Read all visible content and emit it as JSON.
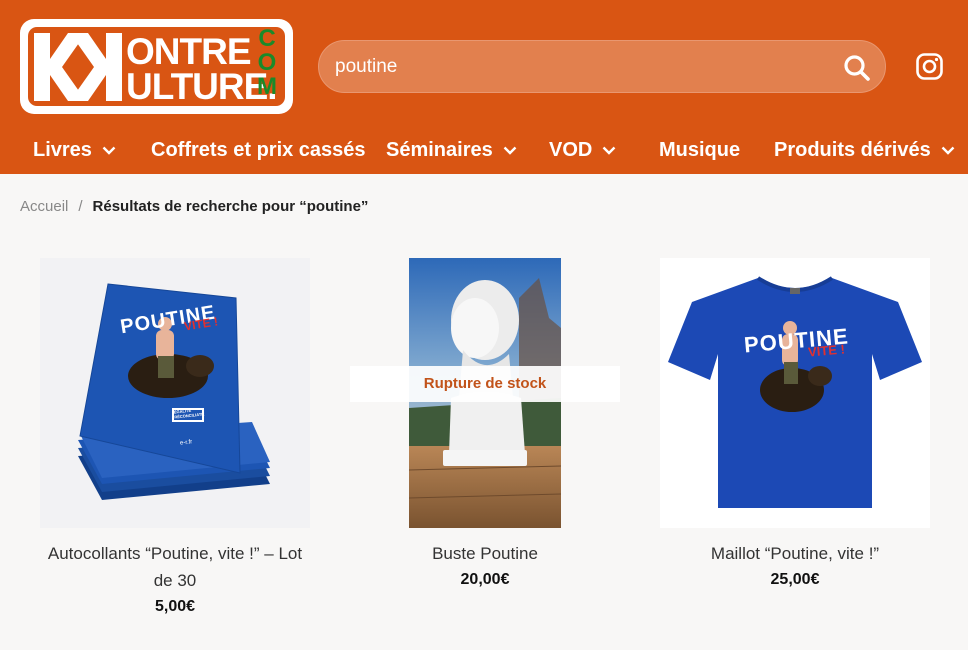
{
  "logo": {
    "line1": "ONTRE",
    "line2": "ULTURE.",
    "com": "COM"
  },
  "search": {
    "value": "poutine"
  },
  "nav": [
    {
      "label": "Livres",
      "has_dropdown": true
    },
    {
      "label": "Coffrets et prix cassés",
      "has_dropdown": false
    },
    {
      "label": "Séminaires",
      "has_dropdown": true
    },
    {
      "label": "VOD",
      "has_dropdown": true
    },
    {
      "label": "Musique",
      "has_dropdown": false
    },
    {
      "label": "Produits dérivés",
      "has_dropdown": true
    }
  ],
  "breadcrumb": {
    "home": "Accueil",
    "separator": "/",
    "current": "Résultats de recherche pour “poutine”"
  },
  "products": [
    {
      "title_line1": "Autocollants “Poutine, vite !” – Lot",
      "title_line2": "de 30",
      "price": "5,00€",
      "poster_text": "POUTINE",
      "poster_sub": "VITE !",
      "badge_text": "ÉGALITÉ RÉCONCILIATION",
      "site_text": "e-r.fr"
    },
    {
      "title": "Buste Poutine",
      "price": "20,00€",
      "badge": "Rupture de stock"
    },
    {
      "title": "Maillot “Poutine, vite !”",
      "price": "25,00€",
      "shirt_text": "POUTINE",
      "shirt_sub": "VITE !"
    }
  ],
  "colors": {
    "brand_orange": "#d95513",
    "logo_green": "#1a8a2a",
    "poster_blue": "#1d55b3",
    "shirt_blue": "#1c49b5",
    "out_of_stock_text": "#c2531a"
  }
}
